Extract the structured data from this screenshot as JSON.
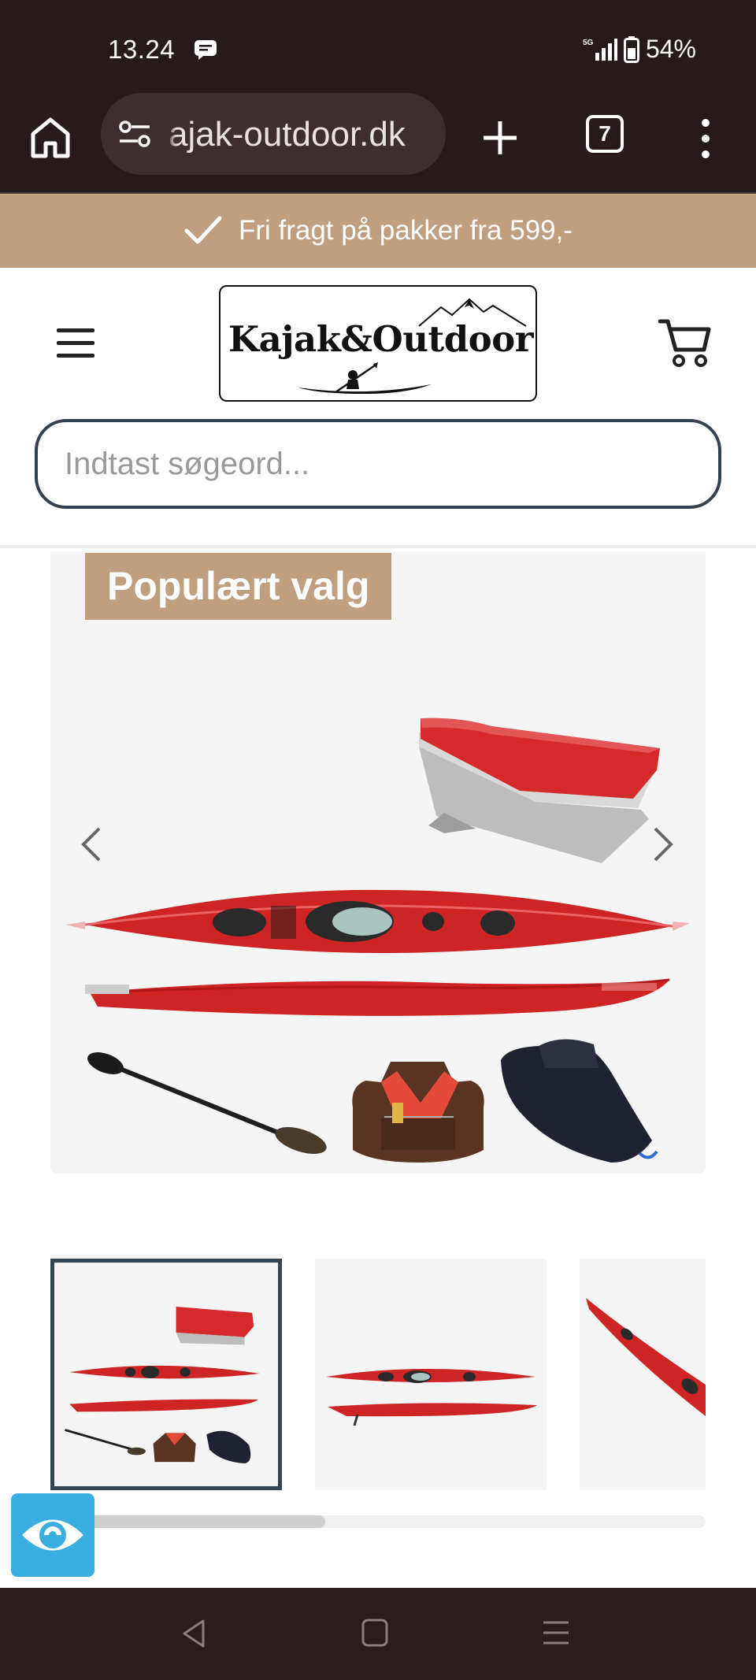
{
  "status_bar": {
    "time": "13.24",
    "network": "5G",
    "battery": "54%",
    "icons": [
      "message-icon",
      "signal-icon",
      "battery-icon"
    ]
  },
  "browser": {
    "url": "ajak-outdoor.dk",
    "tab_count": "7",
    "icons": [
      "home-icon",
      "site-settings-icon",
      "plus-icon",
      "more-vert-icon"
    ]
  },
  "promo": {
    "text": "Fri fragt på pakker fra 599,-",
    "icon": "check-icon"
  },
  "header": {
    "logo_text": "Kajak&Outdoor",
    "search_placeholder": "Indtast søgeord...",
    "icons": [
      "menu-icon",
      "cart-icon"
    ]
  },
  "gallery": {
    "badge": "Populært valg",
    "thumbnail_count": 3,
    "active_thumbnail": 0,
    "scroll_position_fraction": 0.42
  },
  "colors": {
    "chrome_dark": "#271a1b",
    "accent_tan": "#bf9f7f",
    "search_border": "#34404e",
    "kayak_red": "#d42a2a",
    "a11y_blue": "#3aaee0"
  },
  "nav": {
    "icons": [
      "back-icon",
      "home-square-icon",
      "recents-icon"
    ]
  }
}
